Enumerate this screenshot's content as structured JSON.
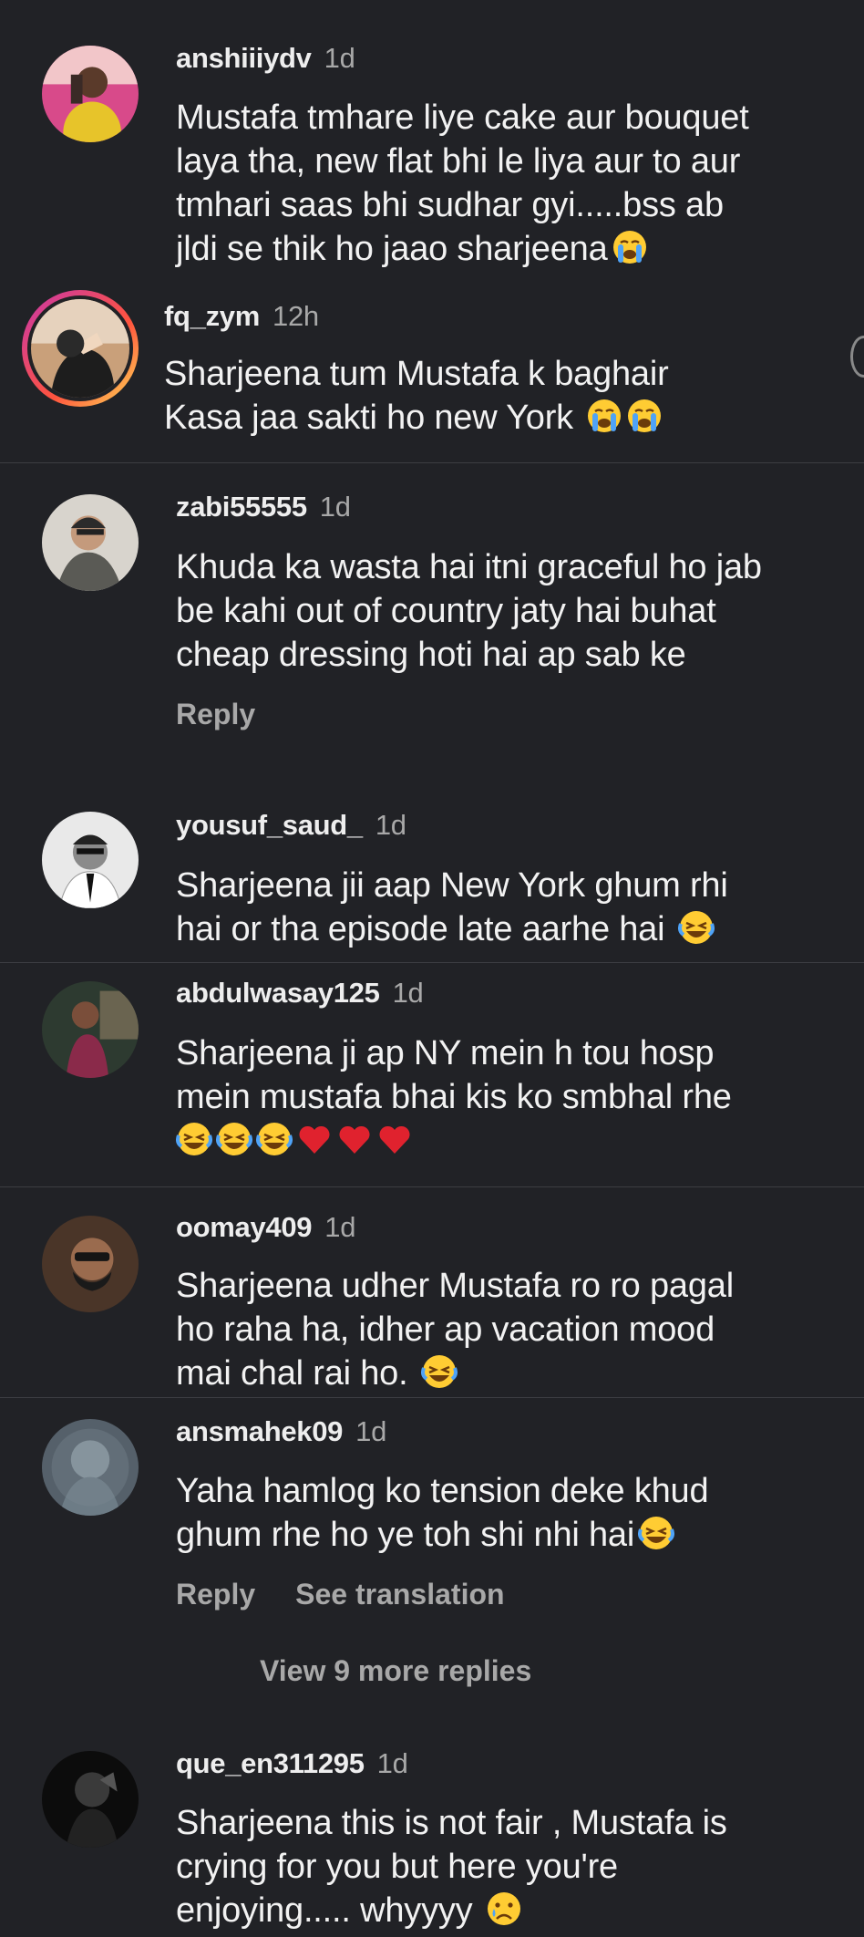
{
  "comments": [
    {
      "username": "anshiiiydv",
      "time": "1d",
      "text": "Mustafa tmhare liye cake aur bouquet\nlaya tha, new flat bhi le liya aur to aur\ntmhari saas bhi sudhar gyi.....bss ab\njldi se thik ho jaao sharjeena",
      "emojis": [
        "crying-emoji"
      ]
    },
    {
      "username": "fq_zym",
      "time": "12h",
      "text": "Sharjeena tum Mustafa k baghair\nKasa jaa sakti ho new York ",
      "emojis": [
        "crying-emoji",
        "crying-emoji"
      ]
    },
    {
      "username": "zabi55555",
      "time": "1d",
      "text": "Khuda ka wasta hai itni graceful ho jab\nbe kahi out of country jaty hai buhat\ncheap dressing hoti hai ap sab ke",
      "actions": [
        "Reply"
      ]
    },
    {
      "username": "yousuf_saud_",
      "time": "1d",
      "text": "Sharjeena jii aap New York ghum rhi\nhai or tha episode late aarhe hai ",
      "emojis": [
        "laughing-emoji"
      ]
    },
    {
      "username": "abdulwasay125",
      "time": "1d",
      "text": "Sharjeena ji ap NY mein h tou hosp\nmein mustafa bhai kis ko smbhal rhe\n",
      "emojis": [
        "laughing-emoji",
        "laughing-emoji",
        "laughing-emoji",
        "heart-emoji",
        "heart-emoji",
        "heart-emoji"
      ]
    },
    {
      "username": "oomay409",
      "time": "1d",
      "text": "Sharjeena udher Mustafa ro ro pagal\nho raha ha, idher ap vacation mood\nmai chal rai ho. ",
      "emojis": [
        "laughing-emoji"
      ]
    },
    {
      "username": "ansmahek09",
      "time": "1d",
      "text": "Yaha hamlog ko tension deke khud\nghum rhe ho ye toh shi nhi hai",
      "emojis": [
        "laughing-emoji"
      ],
      "actions": [
        "Reply",
        "See translation"
      ]
    },
    {
      "username": "que_en311295",
      "time": "1d",
      "text": "Sharjeena this is not fair , Mustafa is\ncrying for you but here you're\nenjoying..... whyyyy ",
      "emojis": [
        "sad-tear-emoji"
      ]
    }
  ],
  "view_more_replies": "View 9 more replies",
  "colors": {
    "background": "#212226",
    "text": "#f2f2f2",
    "muted": "#a8a8a8",
    "divider": "#3c3d42"
  }
}
